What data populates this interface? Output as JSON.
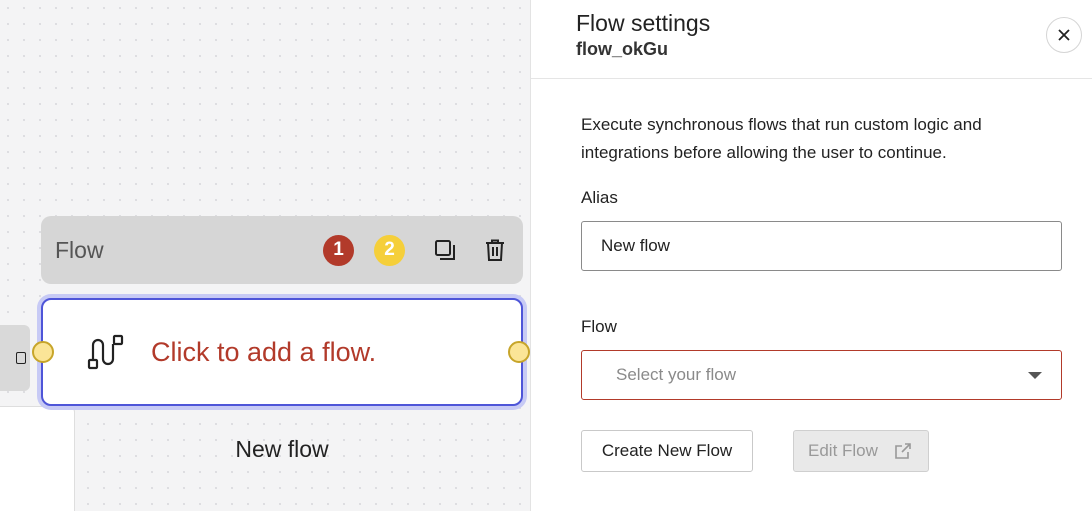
{
  "canvas": {
    "node": {
      "header_title": "Flow",
      "badges": [
        "1",
        "2"
      ],
      "placeholder": "Click to add a flow.",
      "caption": "New flow"
    },
    "icons": [
      "copy-icon",
      "trash-icon",
      "flow-icon"
    ]
  },
  "panel": {
    "title": "Flow settings",
    "subtitle": "flow_okGu",
    "description": "Execute synchronous flows that run custom logic and integrations before allowing the user to continue.",
    "alias_label": "Alias",
    "alias_value": "New flow",
    "flow_label": "Flow",
    "flow_placeholder": "Select your flow",
    "create_button": "Create New Flow",
    "edit_button": "Edit Flow"
  },
  "colors": {
    "accent": "#4e55d8",
    "error": "#b23a2a",
    "badge_yellow": "#f5cf3a"
  }
}
